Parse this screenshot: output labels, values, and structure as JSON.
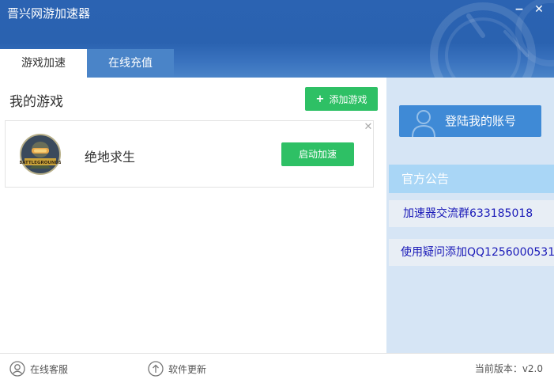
{
  "window": {
    "title": "晋兴网游加速器",
    "minimize_label": "−",
    "close_label": "✕"
  },
  "tabs": [
    {
      "label": "游戏加速",
      "active": true
    },
    {
      "label": "在线充值",
      "active": false
    }
  ],
  "main": {
    "section_title": "我的游戏",
    "add_game_button": {
      "icon": "plus-icon",
      "label": "添加游戏"
    },
    "games": [
      {
        "name": "绝地求生",
        "icon": "pubg-game-icon",
        "start_label": "启动加速",
        "remove_label": "✕"
      }
    ]
  },
  "sidebar": {
    "login_button": {
      "icon": "user-icon",
      "label": "登陆我的账号"
    },
    "notice_header": "官方公告",
    "notices": [
      "加速器交流群633185018",
      "使用疑问添加QQ1256000531"
    ]
  },
  "footer": {
    "support": {
      "icon": "user-circle-icon",
      "label": "在线客服"
    },
    "update": {
      "icon": "upload-circle-icon",
      "label": "软件更新"
    },
    "version": "当前版本：v2.0"
  },
  "colors": {
    "titlebar": "#2b63b2",
    "accent_green": "#2ec065",
    "login_blue": "#3f8ad6",
    "sidebar_bg": "#d6e5f5",
    "notice_header_bg": "#a9d6f6",
    "notice_text": "#1a1ab8"
  }
}
